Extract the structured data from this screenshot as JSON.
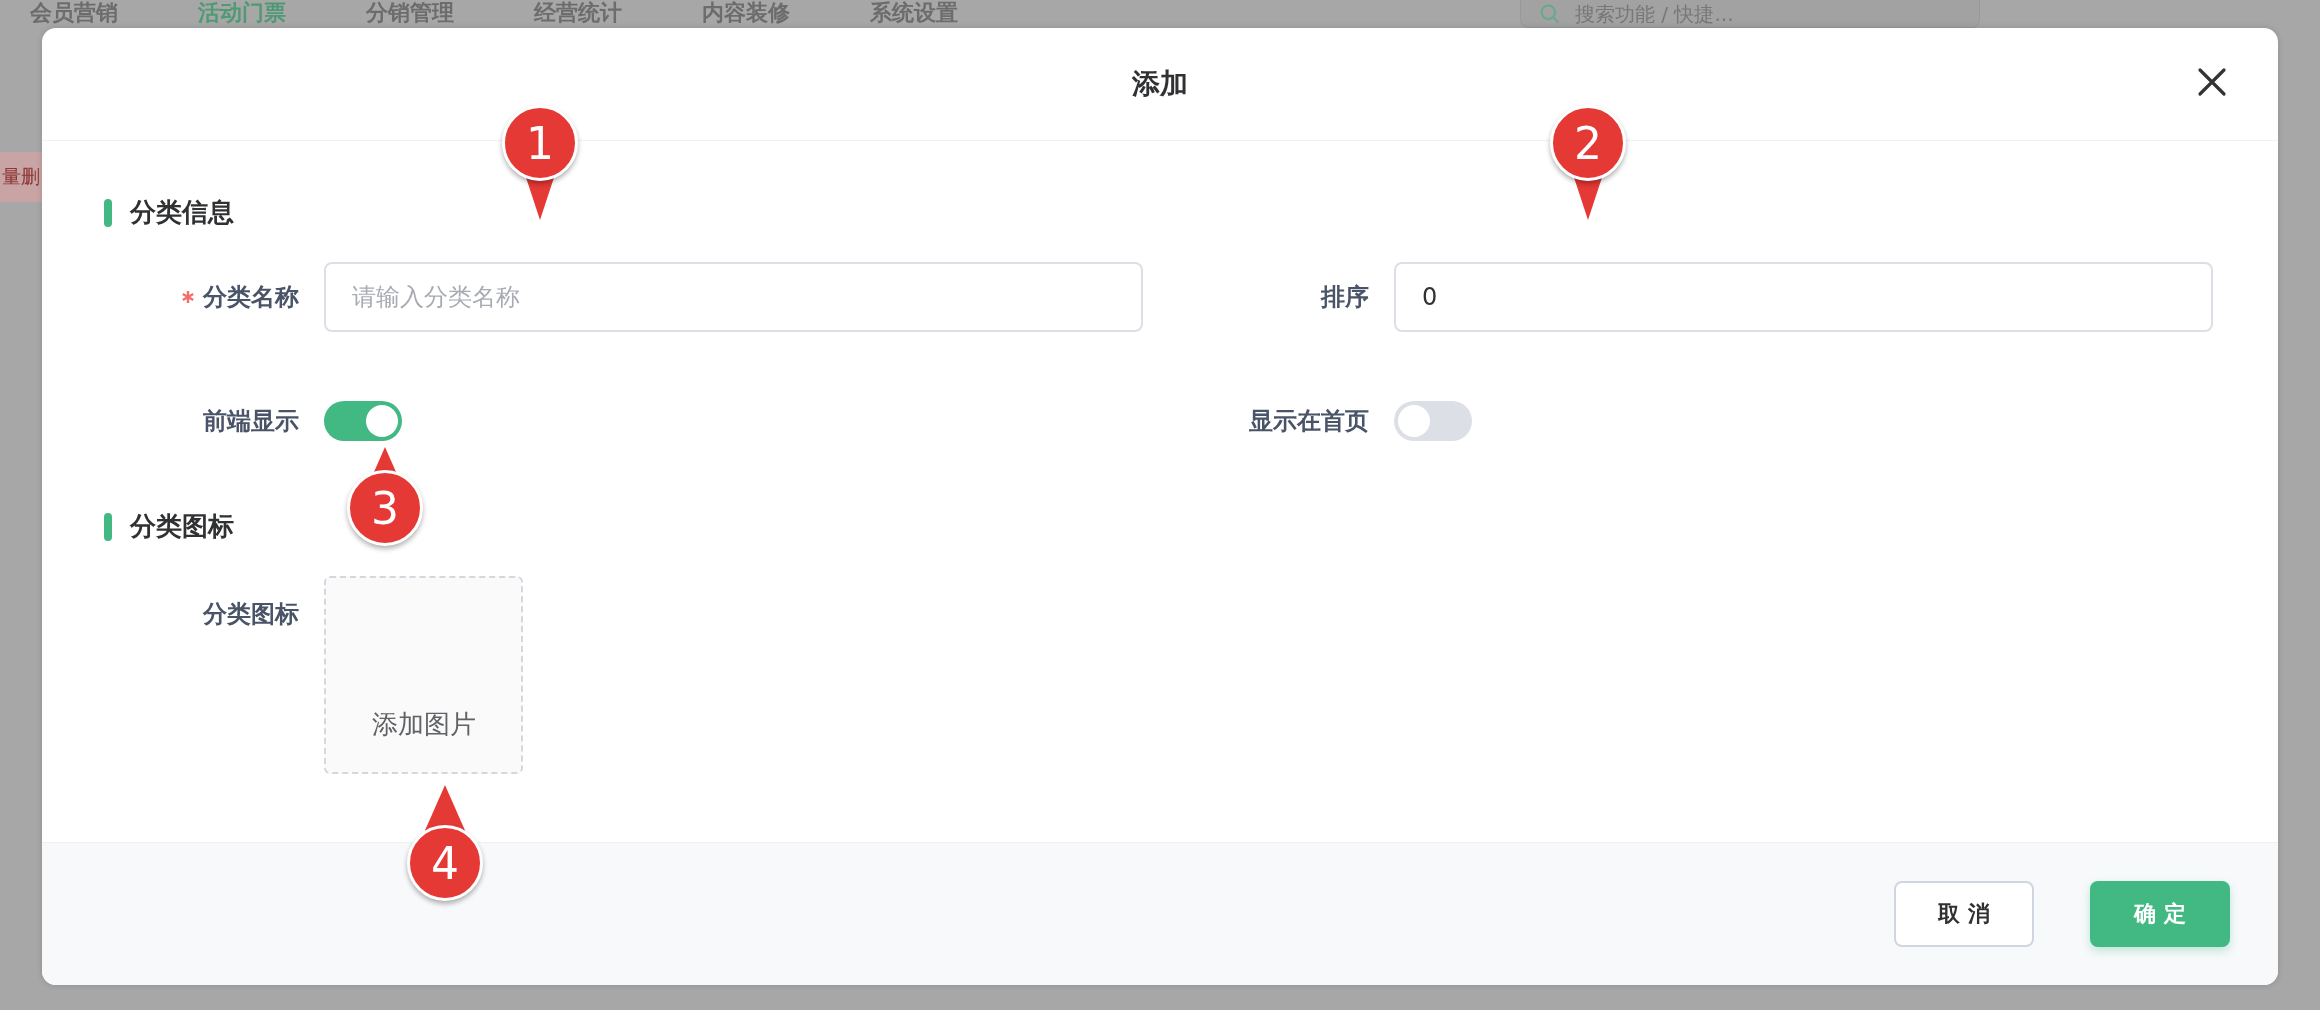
{
  "background": {
    "nav": [
      {
        "label": "会员营销",
        "selected": false
      },
      {
        "label": "活动门票",
        "selected": true
      },
      {
        "label": "分销管理",
        "selected": false
      },
      {
        "label": "经营统计",
        "selected": false
      },
      {
        "label": "内容装修",
        "selected": false
      },
      {
        "label": "系统设置",
        "selected": false
      }
    ],
    "search": {
      "placeholder": "搜索功能 / 快捷..."
    },
    "delete_button": "量删"
  },
  "dialog": {
    "title": "添加",
    "sections": [
      {
        "title": "分类信息",
        "fields": [
          {
            "kind": "text",
            "label": "分类名称",
            "required": true,
            "placeholder": "请输入分类名称"
          },
          {
            "kind": "text",
            "label": "排序",
            "required": false,
            "value": "0"
          },
          {
            "kind": "switch",
            "label": "前端显示",
            "on": true
          },
          {
            "kind": "switch",
            "label": "显示在首页",
            "on": false
          }
        ]
      },
      {
        "title": "分类图标",
        "fields": [
          {
            "kind": "upload",
            "label": "分类图标",
            "text": "添加图片"
          }
        ]
      }
    ],
    "buttons": [
      {
        "label": "取 消",
        "kind": "default"
      },
      {
        "label": "确 定",
        "kind": "primary"
      }
    ]
  },
  "markers": [
    {
      "number": "1"
    },
    {
      "number": "2"
    },
    {
      "number": "3"
    },
    {
      "number": "4"
    }
  ]
}
